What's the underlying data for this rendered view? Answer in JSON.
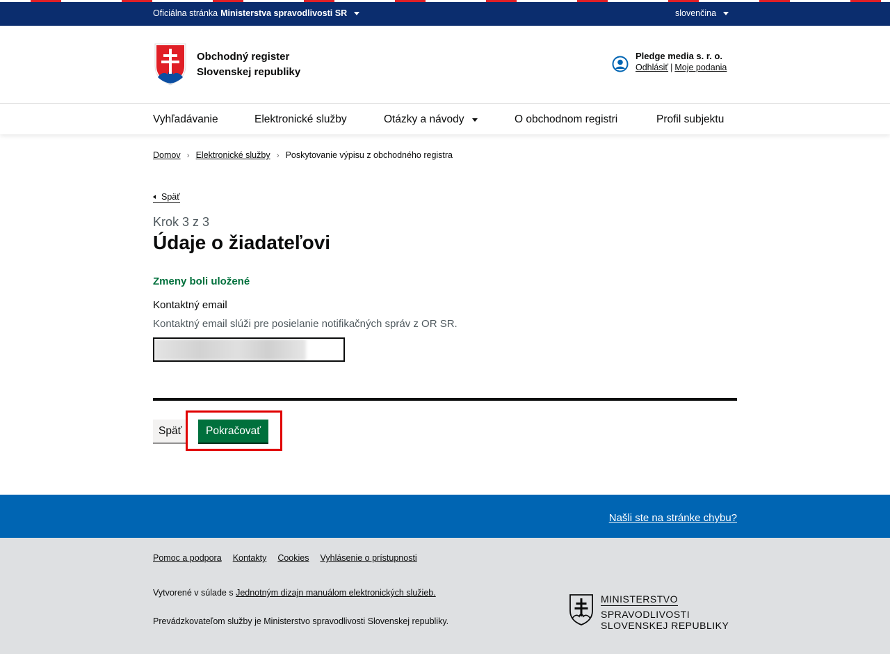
{
  "govbar": {
    "official_prefix": "Oficiálna stránka",
    "official_ministry": "Ministerstva spravodlivosti SR",
    "language": "slovenčina"
  },
  "header": {
    "title_line1": "Obchodný register",
    "title_line2": "Slovenskej republiky",
    "user_name": "Pledge media s. r. o.",
    "logout": "Odhlásiť",
    "my_submissions": "Moje podania",
    "separator": "|"
  },
  "nav": {
    "items": [
      "Vyhľadávanie",
      "Elektronické služby",
      "Otázky a návody",
      "O obchodnom registri",
      "Profil subjektu"
    ]
  },
  "breadcrumb": {
    "home": "Domov",
    "services": "Elektronické služby",
    "current": "Poskytovanie výpisu z obchodného registra"
  },
  "form": {
    "back_link": "Späť",
    "step": "Krok 3 z 3",
    "title": "Údaje o žiadateľovi",
    "saved_message": "Zmeny boli uložené",
    "email_label": "Kontaktný email",
    "email_hint": "Kontaktný email slúži pre posielanie notifikačných správ z OR SR.",
    "back_button": "Späť",
    "continue_button": "Pokračovať"
  },
  "footer": {
    "report_error": "Našli ste na stránke chybu?",
    "links": [
      "Pomoc a podpora",
      "Kontakty",
      "Cookies",
      "Vyhlásenie o prístupnosti"
    ],
    "created_prefix": "Vytvorené v súlade s",
    "created_link": "Jednotným dizajn manuálom elektronických služieb.",
    "operator": "Prevádzkovateľom služby je Ministerstvo spravodlivosti Slovenskej republiky.",
    "ministry_line1": "MINISTERSTVO",
    "ministry_line2": "SPRAVODLIVOSTI",
    "ministry_line3": "SLOVENSKEJ REPUBLIKY"
  },
  "colors": {
    "gov_blue": "#0b2d6e",
    "success_green": "#00703c",
    "footer_blue": "#0065b3",
    "highlight_red": "#e00000"
  }
}
